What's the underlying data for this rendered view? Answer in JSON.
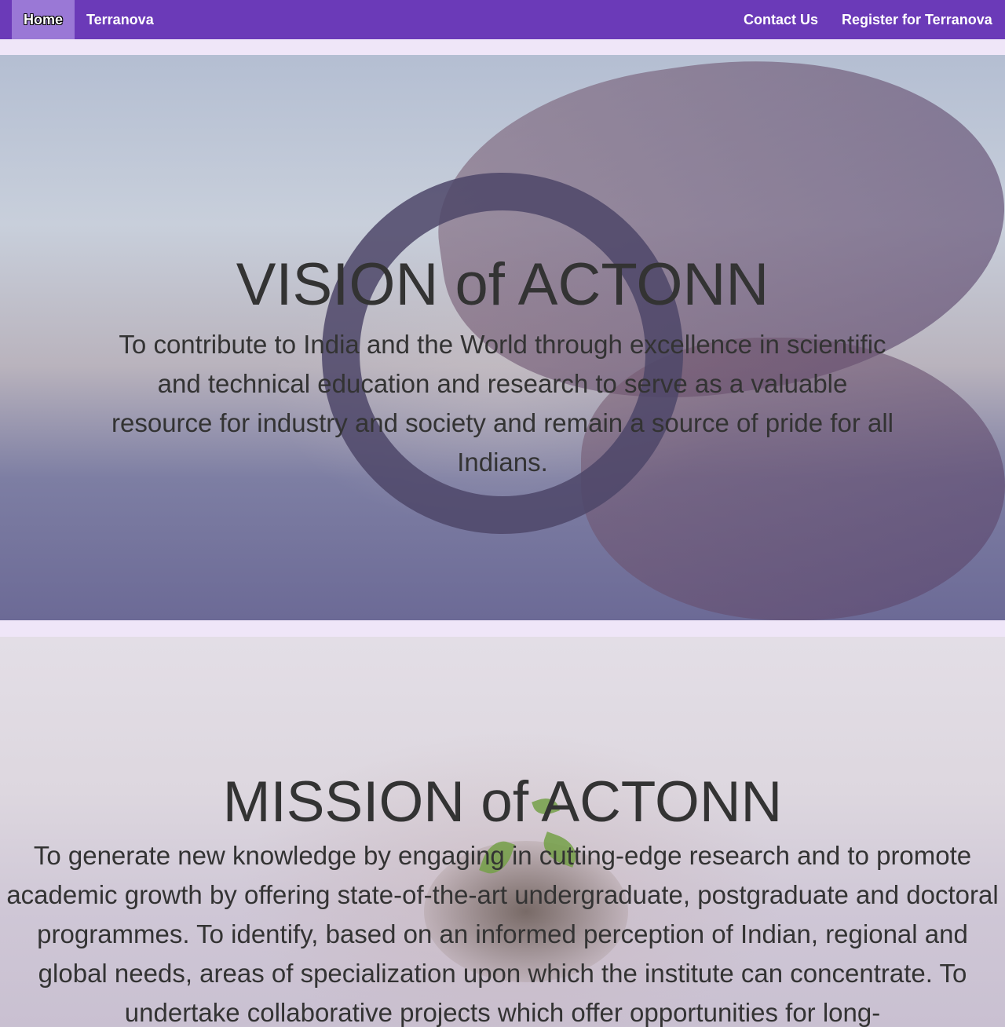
{
  "nav": {
    "home": "Home",
    "terranova": "Terranova",
    "contact": "Contact Us",
    "register": "Register for Terranova"
  },
  "vision": {
    "title": "VISION of ACTONN",
    "text": "To contribute to India and the World through excellence in scientific and technical education and research to serve as a valuable resource for industry and society and remain a source of pride for all Indians.",
    "image": "hand-holding-lens-landscape"
  },
  "mission": {
    "title": "MISSION of ACTONN",
    "text": "To generate new knowledge by engaging in cutting-edge research and to promote academic growth by offering state-of-the-art undergraduate, postgraduate and doctoral programmes. To identify, based on an informed perception of Indian, regional and global needs, areas of specialization upon which the institute can concentrate. To undertake collaborative projects which offer opportunities for long-",
    "image": "hands-holding-seedling"
  },
  "colors": {
    "navbar": "#6b3ab8",
    "nav_active": "#9a78d6",
    "page_background": "#efe6f8",
    "text": "#333333"
  }
}
